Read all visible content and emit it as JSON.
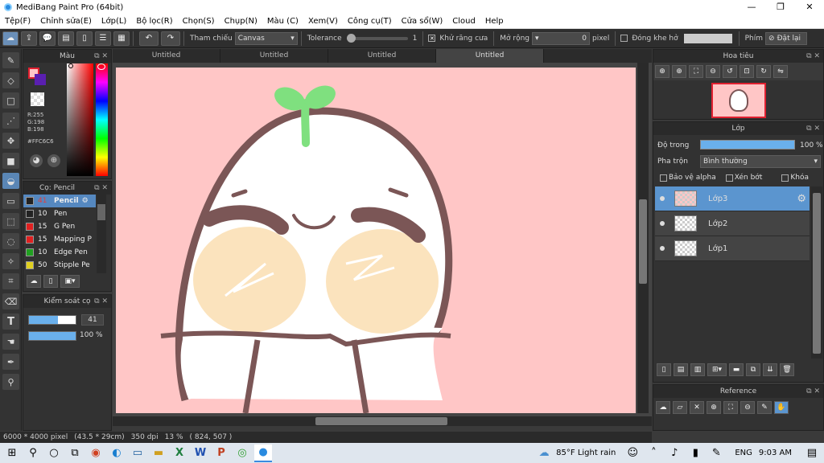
{
  "window": {
    "title": "MediBang Paint Pro (64bit)",
    "minimize": "—",
    "maximize": "❐",
    "close": "✕"
  },
  "menu": [
    "Tệp(F)",
    "Chỉnh sửa(E)",
    "Lớp(L)",
    "Bộ lọc(R)",
    "Chọn(S)",
    "Chụp(N)",
    "Màu (C)",
    "Xem(V)",
    "Công cụ(T)",
    "Cửa sổ(W)",
    "Cloud",
    "Help"
  ],
  "toolbar": {
    "reference_label": "Tham chiếu",
    "reference_value": "Canvas",
    "tolerance_label": "Tolerance",
    "tolerance_value": "1",
    "antialias_label": "Khử răng cưa",
    "expand_label": "Mở rộng",
    "expand_value": "0",
    "pixel_label": "pixel",
    "close_gap_label": "Đóng khe hở",
    "key_label": "Phím",
    "reset_label": "Đặt lại"
  },
  "color_panel": {
    "title": "Màu",
    "rgb_r": "R:255",
    "rgb_g": "G:198",
    "rgb_b": "B:198",
    "hex": "#FFC6C6",
    "main_color": "#ffc6c6"
  },
  "brush_panel": {
    "title": "Cọ: Pencil",
    "brushes": [
      {
        "size": "41",
        "name": "Pencil",
        "color": "#222222",
        "selected": true
      },
      {
        "size": "10",
        "name": "Pen",
        "color": "#222222",
        "selected": false
      },
      {
        "size": "15",
        "name": "G Pen",
        "color": "#e02020",
        "selected": false
      },
      {
        "size": "15",
        "name": "Mapping P",
        "color": "#e02020",
        "selected": false
      },
      {
        "size": "10",
        "name": "Edge Pen",
        "color": "#20a020",
        "selected": false
      },
      {
        "size": "50",
        "name": "Stipple Pe",
        "color": "#e0d020",
        "selected": false
      }
    ]
  },
  "brush_control": {
    "title": "Kiểm soát cọ",
    "size_value": "41",
    "size_fraction": 0.62,
    "opacity_value": "100 %",
    "opacity_fraction": 1.0
  },
  "tabs": [
    "Untitled",
    "Untitled",
    "Untitled",
    "Untitled"
  ],
  "navigator": {
    "title": "Hoa tiêu"
  },
  "layers_panel": {
    "title": "Lớp",
    "opacity_label": "Độ trong",
    "opacity_value": "100 %",
    "blend_label": "Pha trộn",
    "blend_value": "Bình thường",
    "protect_alpha": "Bảo vệ alpha",
    "clipping": "Xén bớt",
    "lock": "Khóa",
    "layers": [
      {
        "name": "Lớp3",
        "selected": true
      },
      {
        "name": "Lớp2",
        "selected": false
      },
      {
        "name": "Lớp1",
        "selected": false
      }
    ]
  },
  "reference_panel": {
    "title": "Reference"
  },
  "status": {
    "size": "6000 * 4000 pixel",
    "cm": "(43.5 * 29cm)",
    "dpi": "350 dpi",
    "zoom": "13 %",
    "coords": "( 824, 507 )"
  },
  "taskbar": {
    "weather": "85°F  Light rain",
    "lang": "ENG",
    "time": "9:03 AM"
  },
  "colors": {
    "canvas_bg": "#ffc6c6",
    "outline": "#7b5656",
    "sprout": "#7fe07f",
    "cheek": "#fbe3bd",
    "accent": "#5b95cf"
  }
}
